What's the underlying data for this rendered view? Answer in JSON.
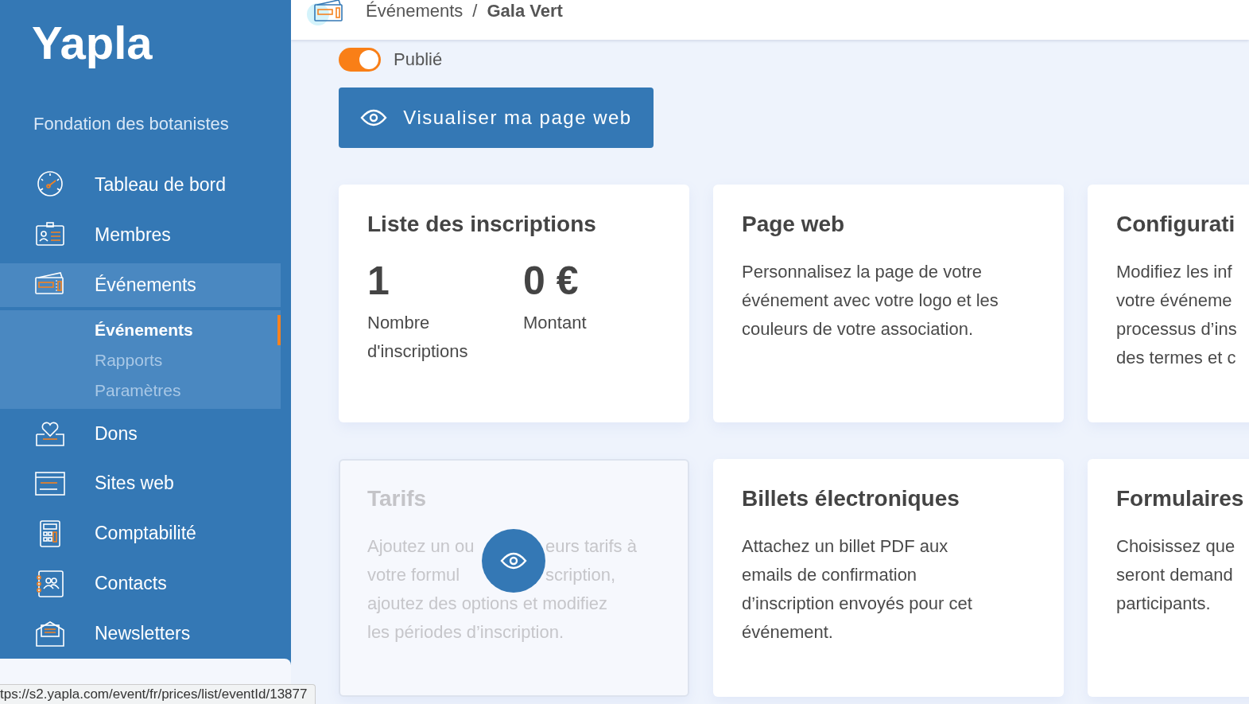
{
  "sidebar": {
    "logo": "Yapla",
    "organization": "Fondation des botanistes",
    "items": [
      {
        "label": "Tableau de bord",
        "selected": false
      },
      {
        "label": "Membres",
        "selected": false
      },
      {
        "label": "Événements",
        "selected": true,
        "children": [
          {
            "label": "Événements",
            "selected": true
          },
          {
            "label": "Rapports",
            "selected": false
          },
          {
            "label": "Paramètres",
            "selected": false
          }
        ]
      },
      {
        "label": "Dons",
        "selected": false
      },
      {
        "label": "Sites web",
        "selected": false
      },
      {
        "label": "Comptabilité",
        "selected": false
      },
      {
        "label": "Contacts",
        "selected": false
      },
      {
        "label": "Newsletters",
        "selected": false
      }
    ]
  },
  "breadcrumb": {
    "separator": "/",
    "items": [
      "Événements",
      "Gala Vert"
    ]
  },
  "publish_toggle": {
    "label": "Publié",
    "on": true
  },
  "view_button": "Visualiser ma page web",
  "cards": [
    {
      "kind": "stats",
      "title": "Liste des inscriptions",
      "disabled": false,
      "stats": [
        {
          "value": "1",
          "label": "Nombre d'inscriptions"
        },
        {
          "value": "0 €",
          "label": "Montant"
        }
      ]
    },
    {
      "kind": "text",
      "title": "Page web",
      "disabled": false,
      "lines": [
        "Personnalisez la page de votre",
        "événement avec votre logo et les",
        "couleurs de votre association."
      ]
    },
    {
      "kind": "text",
      "title": "Configurati",
      "disabled": false,
      "lines": [
        "Modifiez les inf",
        "votre événeme",
        "processus d’ins",
        "des termes et c"
      ]
    },
    {
      "kind": "covered",
      "title": "Tarifs",
      "disabled": true,
      "split_lines": [
        [
          "Ajoutez un ou",
          "eurs tarifs à"
        ],
        [
          "votre formul",
          "scription,"
        ]
      ],
      "lines": [
        "ajoutez des options et modifiez",
        "les périodes d’inscription."
      ]
    },
    {
      "kind": "text",
      "title": "Billets électroniques",
      "disabled": false,
      "lines": [
        "Attachez un billet PDF aux",
        "emails de confirmation",
        "d’inscription envoyés pour cet",
        "événement."
      ]
    },
    {
      "kind": "text",
      "title": "Formulaires",
      "disabled": false,
      "lines": [
        "Choisissez que",
        "seront demand",
        "participants."
      ]
    }
  ],
  "status_bar": "tps://s2.yapla.com/event/fr/prices/list/eventId/13877"
}
